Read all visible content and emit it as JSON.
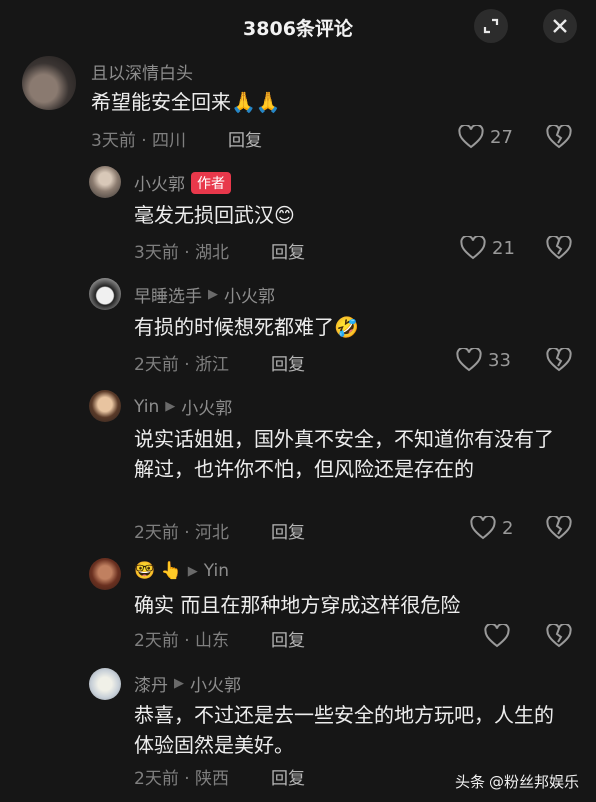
{
  "header": {
    "title": "3806条评论"
  },
  "comments": [
    {
      "name": "且以深情白头",
      "text": "希望能安全回来🙏🙏",
      "meta": "3天前 · 四川",
      "reply_label": "回复",
      "likes": "27"
    },
    {
      "name": "小火郭",
      "badge": "作者",
      "text": "毫发无损回武汉😊",
      "meta": "3天前 · 湖北",
      "reply_label": "回复",
      "likes": "21"
    },
    {
      "name": "早睡选手",
      "reply_to": "小火郭",
      "text": "有损的时候想死都难了🤣",
      "meta": "2天前 · 浙江",
      "reply_label": "回复",
      "likes": "33"
    },
    {
      "name": "Yin",
      "reply_to": "小火郭",
      "text": "说实话姐姐，国外真不安全，不知道你有没有了解过，也许你不怕，但风险还是存在的",
      "meta": "2天前 · 河北",
      "reply_label": "回复",
      "likes": "2"
    },
    {
      "name": "🤓 👆",
      "reply_to": "Yin",
      "text": "确实  而且在那种地方穿成这样很危险",
      "meta": "2天前 · 山东",
      "reply_label": "回复",
      "likes": ""
    },
    {
      "name": "漆丹",
      "reply_to": "小火郭",
      "text": "恭喜，不过还是去一些安全的地方玩吧，人生的体验固然是美好。",
      "meta": "2天前 · 陕西",
      "reply_label": "回复",
      "likes": ""
    }
  ],
  "watermark": {
    "brand": "头条",
    "account": "@粉丝邦娱乐"
  }
}
